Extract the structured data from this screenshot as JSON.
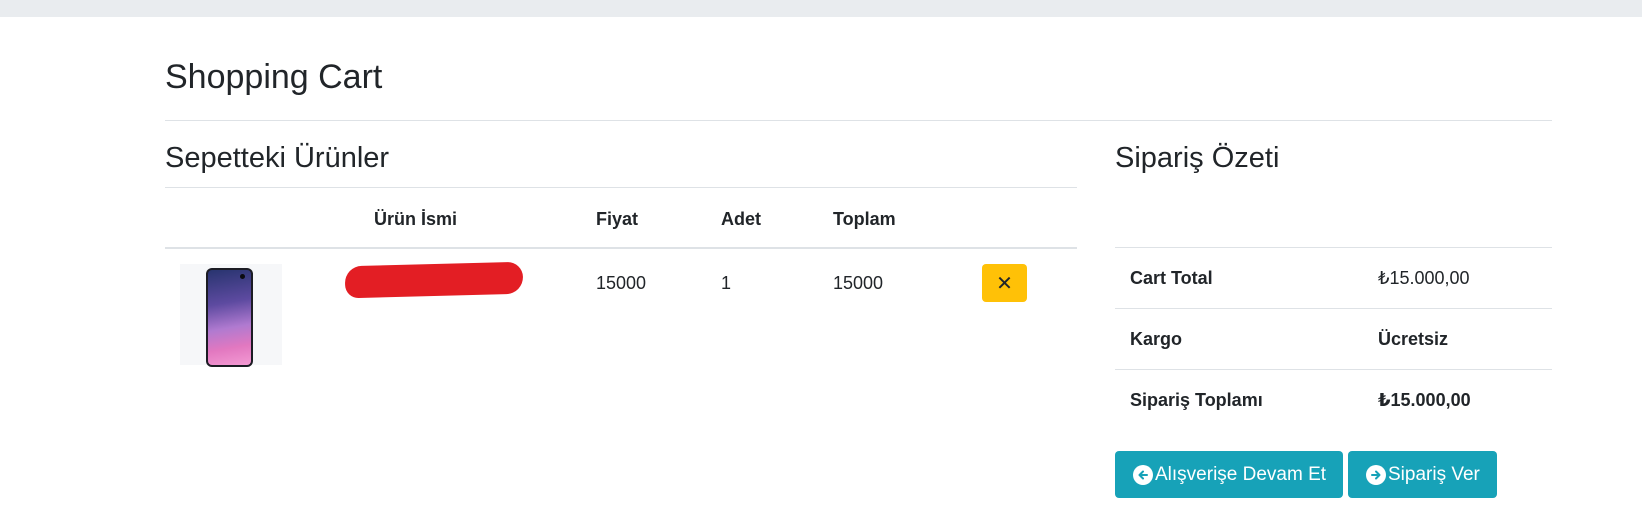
{
  "page": {
    "title": "Shopping Cart"
  },
  "cart": {
    "section_title": "Sepetteki Ürünler",
    "columns": {
      "image": "",
      "name": "Ürün İsmi",
      "price": "Fiyat",
      "quantity": "Adet",
      "total": "Toplam"
    },
    "items": [
      {
        "image_icon": "smartphone-image",
        "name_redacted": true,
        "price": "15000",
        "quantity": "1",
        "total": "15000",
        "remove_label": "✕"
      }
    ]
  },
  "summary": {
    "section_title": "Sipariş Özeti",
    "rows": [
      {
        "label": "Cart Total",
        "value": "₺15.000,00"
      },
      {
        "label": "Kargo",
        "value": "Ücretsiz"
      },
      {
        "label": "Sipariş Toplamı",
        "value": "₺15.000,00"
      }
    ]
  },
  "buttons": {
    "continue_label": "Alışverişe Devam Et",
    "continue_icon": "arrow-circle-left-icon",
    "order_label": "Sipariş Ver",
    "order_icon": "arrow-circle-right-icon"
  },
  "colors": {
    "topbar": "#e9ecef",
    "remove_button": "#ffc107",
    "action_button": "#17a2b8",
    "redaction": "#e31e24"
  }
}
